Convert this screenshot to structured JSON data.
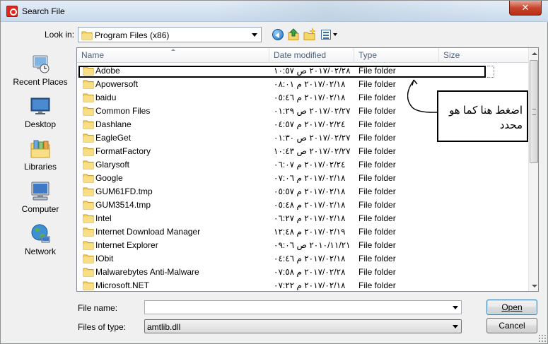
{
  "window": {
    "title": "Search File",
    "close_glyph": "✕"
  },
  "toolbar": {
    "look_in_label": "Look in:",
    "look_in_value": "Program Files (x86)",
    "icons": [
      "back-icon",
      "up-folder-icon",
      "new-folder-icon",
      "views-menu-icon"
    ]
  },
  "places": [
    {
      "label": "Recent Places",
      "icon": "recent-places-icon"
    },
    {
      "label": "Desktop",
      "icon": "desktop-icon"
    },
    {
      "label": "Libraries",
      "icon": "libraries-icon"
    },
    {
      "label": "Computer",
      "icon": "computer-icon"
    },
    {
      "label": "Network",
      "icon": "network-icon"
    }
  ],
  "columns": [
    "Name",
    "Date modified",
    "Type",
    "Size"
  ],
  "files": [
    {
      "name": "Adobe",
      "date": "٢٠١٧/٠٢/٢٨ ص ١٠:٥٧",
      "type": "File folder"
    },
    {
      "name": "Apowersoft",
      "date": "٢٠١٧/٠٢/١٨ م ٠٨:٠١",
      "type": "File folder"
    },
    {
      "name": "baidu",
      "date": "٢٠١٧/٠٢/١٨ م ٠٥:٤٦",
      "type": "File folder"
    },
    {
      "name": "Common Files",
      "date": "٢٠١٧/٠٢/٢٧ ص ٠١:٢٩",
      "type": "File folder"
    },
    {
      "name": "Dashlane",
      "date": "٢٠١٧/٠٢/٢٤ م ٠٤:٥٧",
      "type": "File folder"
    },
    {
      "name": "EagleGet",
      "date": "٢٠١٧/٠٢/٢٧ ص ٠١:٣٠",
      "type": "File folder"
    },
    {
      "name": "FormatFactory",
      "date": "٢٠١٧/٠٢/٢٧ ص ١٠:٤٣",
      "type": "File folder"
    },
    {
      "name": "Glarysoft",
      "date": "٢٠١٧/٠٢/٢٤ م ٠٦:٠٧",
      "type": "File folder"
    },
    {
      "name": "Google",
      "date": "٢٠١٧/٠٢/١٨ م ٠٧:٠٦",
      "type": "File folder"
    },
    {
      "name": "GUM61FD.tmp",
      "date": "٢٠١٧/٠٢/١٨ م ٠٥:٥٧",
      "type": "File folder"
    },
    {
      "name": "GUM3514.tmp",
      "date": "٢٠١٧/٠٢/١٨ م ٠٥:٤٨",
      "type": "File folder"
    },
    {
      "name": "Intel",
      "date": "٢٠١٧/٠٢/١٨ م ٠٦:٢٧",
      "type": "File folder"
    },
    {
      "name": "Internet Download Manager",
      "date": "٢٠١٧/٠٢/١٩ م ١٢:٤٨",
      "type": "File folder"
    },
    {
      "name": "Internet Explorer",
      "date": "٢٠١٠/١١/٢١ ص ٠٩:٠٦",
      "type": "File folder"
    },
    {
      "name": "IObit",
      "date": "٢٠١٧/٠٢/١٨ م ٠٤:٤٦",
      "type": "File folder"
    },
    {
      "name": "Malwarebytes Anti-Malware",
      "date": "٢٠١٧/٠٢/٢٨ م ٠٧:٥٨",
      "type": "File folder"
    },
    {
      "name": "Microsoft.NET",
      "date": "٢٠١٧/٠٢/١٨ م ٠٧:٢٢",
      "type": "File folder"
    }
  ],
  "annotation": {
    "text": "اضغط هنا كما هو محدد"
  },
  "bottom": {
    "file_name_label": "File name:",
    "file_name_value": "",
    "file_type_label": "Files of type:",
    "file_type_value": "amtlib.dll",
    "open_label": "Open",
    "cancel_label": "Cancel"
  },
  "colors": {
    "folder": "#f2c94c",
    "title_bg": "#c9daec",
    "close": "#c7462e",
    "header_text": "#4c607a"
  }
}
